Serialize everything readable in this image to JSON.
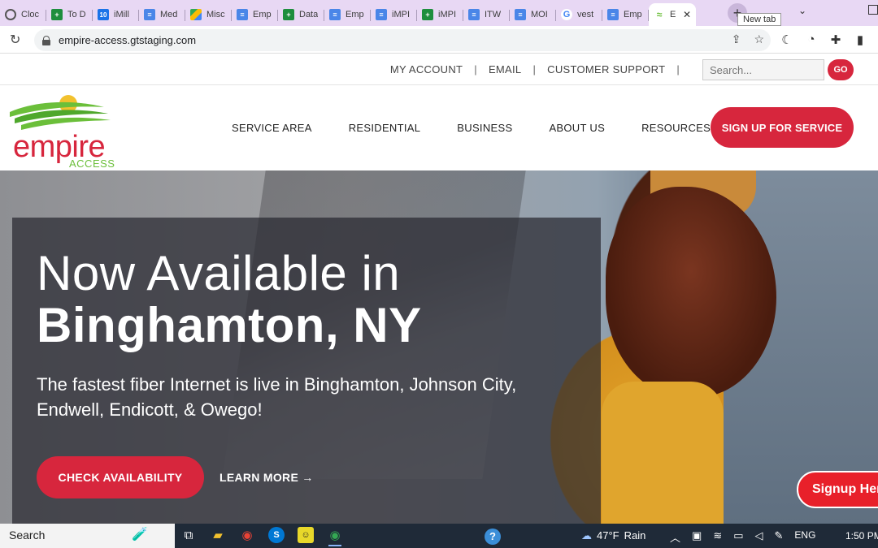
{
  "browser": {
    "tabs": [
      {
        "label": "Cloc",
        "icon": "clock-icon"
      },
      {
        "label": "To D",
        "icon": "sheets-icon"
      },
      {
        "label": "iMill",
        "icon": "calendar-icon"
      },
      {
        "label": "Med",
        "icon": "docs-icon"
      },
      {
        "label": "Misc",
        "icon": "drive-icon"
      },
      {
        "label": "Emp",
        "icon": "docs-icon"
      },
      {
        "label": "Data",
        "icon": "sheets-icon"
      },
      {
        "label": "Emp",
        "icon": "docs-icon"
      },
      {
        "label": "iMPI",
        "icon": "docs-icon"
      },
      {
        "label": "iMPI",
        "icon": "sheets-icon"
      },
      {
        "label": "ITW",
        "icon": "docs-icon"
      },
      {
        "label": "MOI",
        "icon": "docs-icon"
      },
      {
        "label": "vest",
        "icon": "google-icon"
      },
      {
        "label": "Emp",
        "icon": "docs-icon"
      }
    ],
    "active_tab": {
      "label": "E",
      "icon": "empire-icon",
      "close": "✕"
    },
    "new_tab_tooltip": "New tab",
    "url": "empire-access.gtstaging.com"
  },
  "utility_nav": {
    "links": [
      "MY ACCOUNT",
      "EMAIL",
      "CUSTOMER SUPPORT"
    ],
    "search_placeholder": "Search...",
    "go_label": "GO"
  },
  "logo": {
    "word": "empire",
    "sub": "ACCESS"
  },
  "main_nav": {
    "items": [
      "SERVICE AREA",
      "RESIDENTIAL",
      "BUSINESS",
      "ABOUT US",
      "RESOURCES"
    ],
    "cta": "SIGN UP FOR SERVICE"
  },
  "hero": {
    "line1": "Now Available in",
    "line2": "Binghamton, NY",
    "subtitle": "The fastest fiber Internet is live in Binghamton, Johnson City, Endwell, Endicott, & Owego!",
    "primary_button": "CHECK AVAILABILITY",
    "secondary_link": "LEARN MORE →",
    "floating_button": "Signup Here"
  },
  "taskbar": {
    "search_label": "Search",
    "weather_temp": "47°F",
    "weather_text": "Rain",
    "language": "ENG",
    "time": "1:50 PM"
  },
  "colors": {
    "brand_red": "#d7263d",
    "brand_green": "#6bbf3a",
    "tab_strip": "#e8d8f4"
  }
}
